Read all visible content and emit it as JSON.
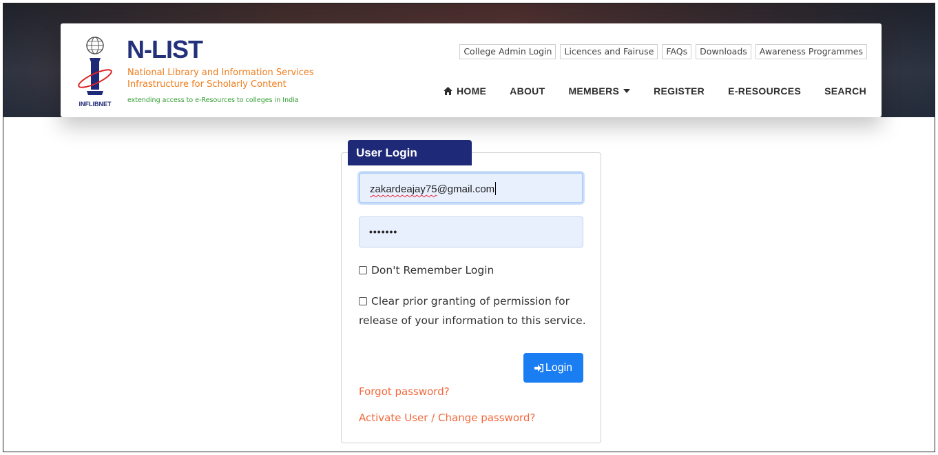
{
  "brand": {
    "title": "N-LIST",
    "line1": "National Library and Information Services",
    "line2": "Infrastructure for Scholarly Content",
    "tagline": "extending access to e-Resources to colleges in India",
    "logo_text": "INFLIBNET",
    "title_color": "#23307a",
    "subtitle_color": "#f07c1b",
    "tagline_color": "#2f9b2f"
  },
  "top_links": [
    "College Admin Login",
    "Licences and Fairuse",
    "FAQs",
    "Downloads",
    "Awareness Programmes"
  ],
  "nav": {
    "home": "HOME",
    "about": "ABOUT",
    "members": "MEMBERS",
    "register": "REGISTER",
    "eresources": "E-RESOURCES",
    "search": "SEARCH"
  },
  "login": {
    "title": "User Login",
    "email_value": "zakardeajay75@gmail.com",
    "email_misspelled_part": "zakardeajay75",
    "email_rest": "@gmail.com",
    "password_mask": "•••••••",
    "check_dont_remember": "Don't Remember Login",
    "check_clear_line1": "Clear prior granting of permission for",
    "check_clear_line2": "release of your information to this service.",
    "button": "Login",
    "forgot": "Forgot password?",
    "activate": "Activate User / Change password?",
    "accent_color": "#1e2a78",
    "button_color": "#1a7ef2",
    "link_color": "#f2683c"
  },
  "icons": {
    "home": "house-icon",
    "members_caret": "caret-down-icon",
    "login_button": "sign-in-icon",
    "logo": "inflibnet-globe-logo"
  }
}
